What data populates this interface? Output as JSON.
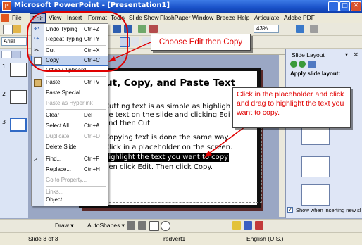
{
  "window": {
    "title": "Microsoft PowerPoint - [Presentation1]",
    "app_icon": "P",
    "minimize": "_",
    "restore": "□",
    "close": "✕"
  },
  "menubar": {
    "items": [
      "File",
      "Edit",
      "View",
      "Insert",
      "Format",
      "Tools",
      "Slide Show",
      "FlashPaper",
      "Window",
      "Breeze",
      "Help",
      "Articulate",
      "Adobe PDF"
    ]
  },
  "toolbar": {
    "font_name": "Arial",
    "zoom": "43%"
  },
  "edit_menu": {
    "items": [
      {
        "label": "Undo Typing",
        "shortcut": "Ctrl+Z",
        "enabled": true,
        "icon": "undo-icon"
      },
      {
        "label": "Repeat Typing",
        "shortcut": "Ctrl+Y",
        "enabled": true,
        "icon": "redo-icon"
      },
      {
        "label": "Cut",
        "shortcut": "Ctrl+X",
        "enabled": true,
        "icon": "cut-icon"
      },
      {
        "label": "Copy",
        "shortcut": "Ctrl+C",
        "enabled": true,
        "icon": "copy-icon",
        "selected": true
      },
      {
        "label": "Office Clipboard...",
        "shortcut": "",
        "enabled": true,
        "icon": ""
      },
      {
        "label": "Paste",
        "shortcut": "Ctrl+V",
        "enabled": true,
        "icon": "paste-icon"
      },
      {
        "label": "Paste Special...",
        "shortcut": "",
        "enabled": true,
        "icon": ""
      },
      {
        "label": "Paste as Hyperlink",
        "shortcut": "",
        "enabled": false,
        "icon": ""
      },
      {
        "label": "Clear",
        "shortcut": "Del",
        "enabled": true,
        "icon": ""
      },
      {
        "label": "Select All",
        "shortcut": "Ctrl+A",
        "enabled": true,
        "icon": ""
      },
      {
        "label": "Duplicate",
        "shortcut": "Ctrl+D",
        "enabled": false,
        "icon": ""
      },
      {
        "label": "Delete Slide",
        "shortcut": "",
        "enabled": true,
        "icon": ""
      },
      {
        "label": "Find...",
        "shortcut": "Ctrl+F",
        "enabled": true,
        "icon": "find-icon"
      },
      {
        "label": "Replace...",
        "shortcut": "Ctrl+H",
        "enabled": true,
        "icon": ""
      },
      {
        "label": "Go to Property...",
        "shortcut": "",
        "enabled": false,
        "icon": ""
      },
      {
        "label": "Links...",
        "shortcut": "",
        "enabled": false,
        "icon": ""
      },
      {
        "label": "Object",
        "shortcut": "",
        "enabled": true,
        "icon": ""
      }
    ]
  },
  "slide": {
    "title": "ut, Copy, and Paste Text",
    "lines": [
      "Cutting text is as simple as highligh",
      "he text on the slide and clicking Edi",
      "and then Cut",
      "Copying text is done the same way.",
      "Click in a placeholder on the screen.",
      "highlight the text you want to copy and",
      "hen click Edit. Then click Copy."
    ]
  },
  "slide_thumbnails": [
    "1",
    "2",
    "3"
  ],
  "task_pane": {
    "title": "Slide Layout",
    "subtitle": "Apply slide layout:",
    "checkbox_label": "Show when inserting new slides"
  },
  "callouts": {
    "edit_copy": "Choose Edit then Copy",
    "highlight": "Click in the placeholder and click and drag to highlight the text you want to copy."
  },
  "drawing_toolbar": {
    "draw_label": "Draw ▾",
    "autoshapes_label": "AutoShapes ▾"
  },
  "status": {
    "slide": "Slide 3 of 3",
    "design": "redvert1",
    "language": "English (U.S.)"
  },
  "colors": {
    "title_bar": "#1a52c9",
    "callout_text": "#e00000",
    "menu_highlight": "#c1d2ee"
  }
}
